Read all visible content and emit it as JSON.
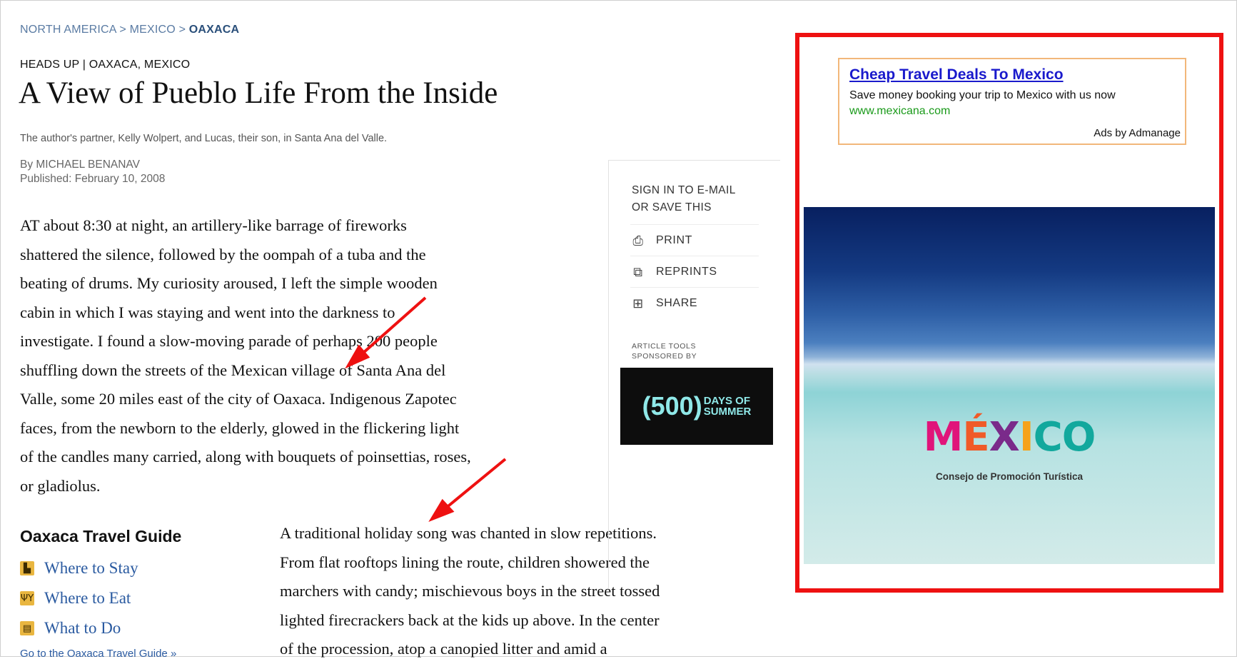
{
  "breadcrumb": {
    "part1": "NORTH AMERICA > MEXICO > ",
    "current": "OAXACA"
  },
  "article": {
    "kicker": "HEADS UP | OAXACA, MEXICO",
    "headline": "A View of Pueblo Life From the Inside",
    "caption": "The author's partner, Kelly Wolpert, and Lucas, their son, in Santa Ana del Valle.",
    "byline": "By MICHAEL BENANAV",
    "published": "Published: February 10, 2008",
    "para1_lines": [
      "AT about 8:30 at night, an artillery-like barrage of fireworks",
      "shattered the silence, followed by the oompah of a tuba and the",
      "beating of drums. My curiosity aroused, I left the simple wooden",
      "cabin in which I was staying and went into the darkness to",
      "investigate. I found a slow-moving parade of perhaps 200 people",
      "shuffling down the streets of the Mexican village of Santa Ana del",
      "Valle, some 20 miles east of the city of Oaxaca. Indigenous Zapotec",
      "faces, from the newborn to the elderly, glowed in the flickering light",
      "of the candles many carried, along with bouquets of poinsettias, roses,",
      "or gladiolus."
    ],
    "para2_lines": [
      "A traditional holiday song was chanted in slow repetitions.",
      "From flat rooftops lining the route, children showered the",
      "marchers with candy; mischievous boys in the street tossed",
      "lighted firecrackers back at the kids up above. In the center",
      "of the procession, atop a canopied litter and amid a"
    ]
  },
  "travel_guide": {
    "title": "Oaxaca Travel Guide",
    "items": [
      {
        "label": "Where to Stay",
        "icon": "bed-icon"
      },
      {
        "label": "Where to Eat",
        "icon": "utensils-icon"
      },
      {
        "label": "What to Do",
        "icon": "list-icon"
      }
    ],
    "link": "Go to the Oaxaca Travel Guide »"
  },
  "tools": {
    "signin_line1": "SIGN IN TO E-MAIL",
    "signin_line2": "OR SAVE THIS",
    "print": "PRINT",
    "reprints": "REPRINTS",
    "share": "SHARE",
    "sponsored_line1": "ARTICLE TOOLS",
    "sponsored_line2": "SPONSORED BY",
    "sponsor_big": "(500)",
    "sponsor_small1": "DAYS OF",
    "sponsor_small2": "SUMMER"
  },
  "ad": {
    "title": "Cheap Travel Deals To Mexico",
    "description": "Save money booking your trip to Mexico with us now",
    "url": "www.mexicana.com",
    "ads_by": "Ads by Admanage",
    "banner_logo": "MÉXICO",
    "banner_sub": "Consejo de Promoción Turística",
    "highlight_color": "#ee1111"
  }
}
